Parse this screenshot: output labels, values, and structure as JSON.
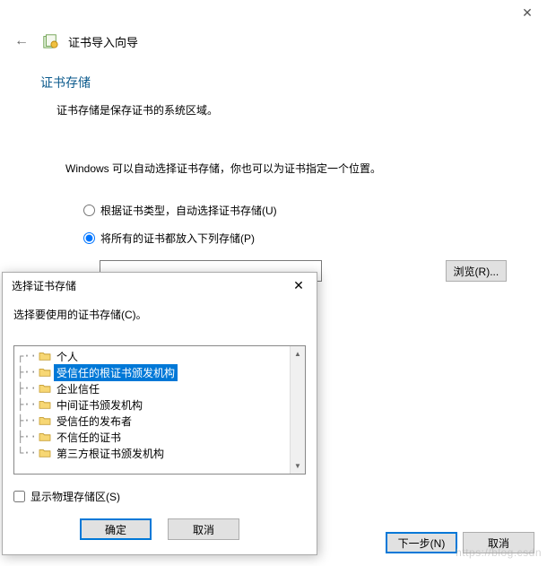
{
  "wizard": {
    "title": "证书导入向导",
    "section_heading": "证书存储",
    "section_desc": "证书存储是保存证书的系统区域。",
    "instruction": "Windows 可以自动选择证书存储，你也可以为证书指定一个位置。",
    "radio_auto": "根据证书类型，自动选择证书存储(U)",
    "radio_manual": "将所有的证书都放入下列存储(P)",
    "store_value": "",
    "browse_label": "浏览(R)...",
    "next_label": "下一步(N)",
    "cancel_label": "取消"
  },
  "dialog": {
    "title": "选择证书存储",
    "instruction": "选择要使用的证书存储(C)。",
    "tree_items": [
      "个人",
      "受信任的根证书颁发机构",
      "企业信任",
      "中间证书颁发机构",
      "受信任的发布者",
      "不信任的证书",
      "第三方根证书颁发机构"
    ],
    "selected_index": 1,
    "show_physical_label": "显示物理存储区(S)",
    "ok_label": "确定",
    "cancel_label": "取消"
  },
  "watermark": "https://blog.csdn"
}
